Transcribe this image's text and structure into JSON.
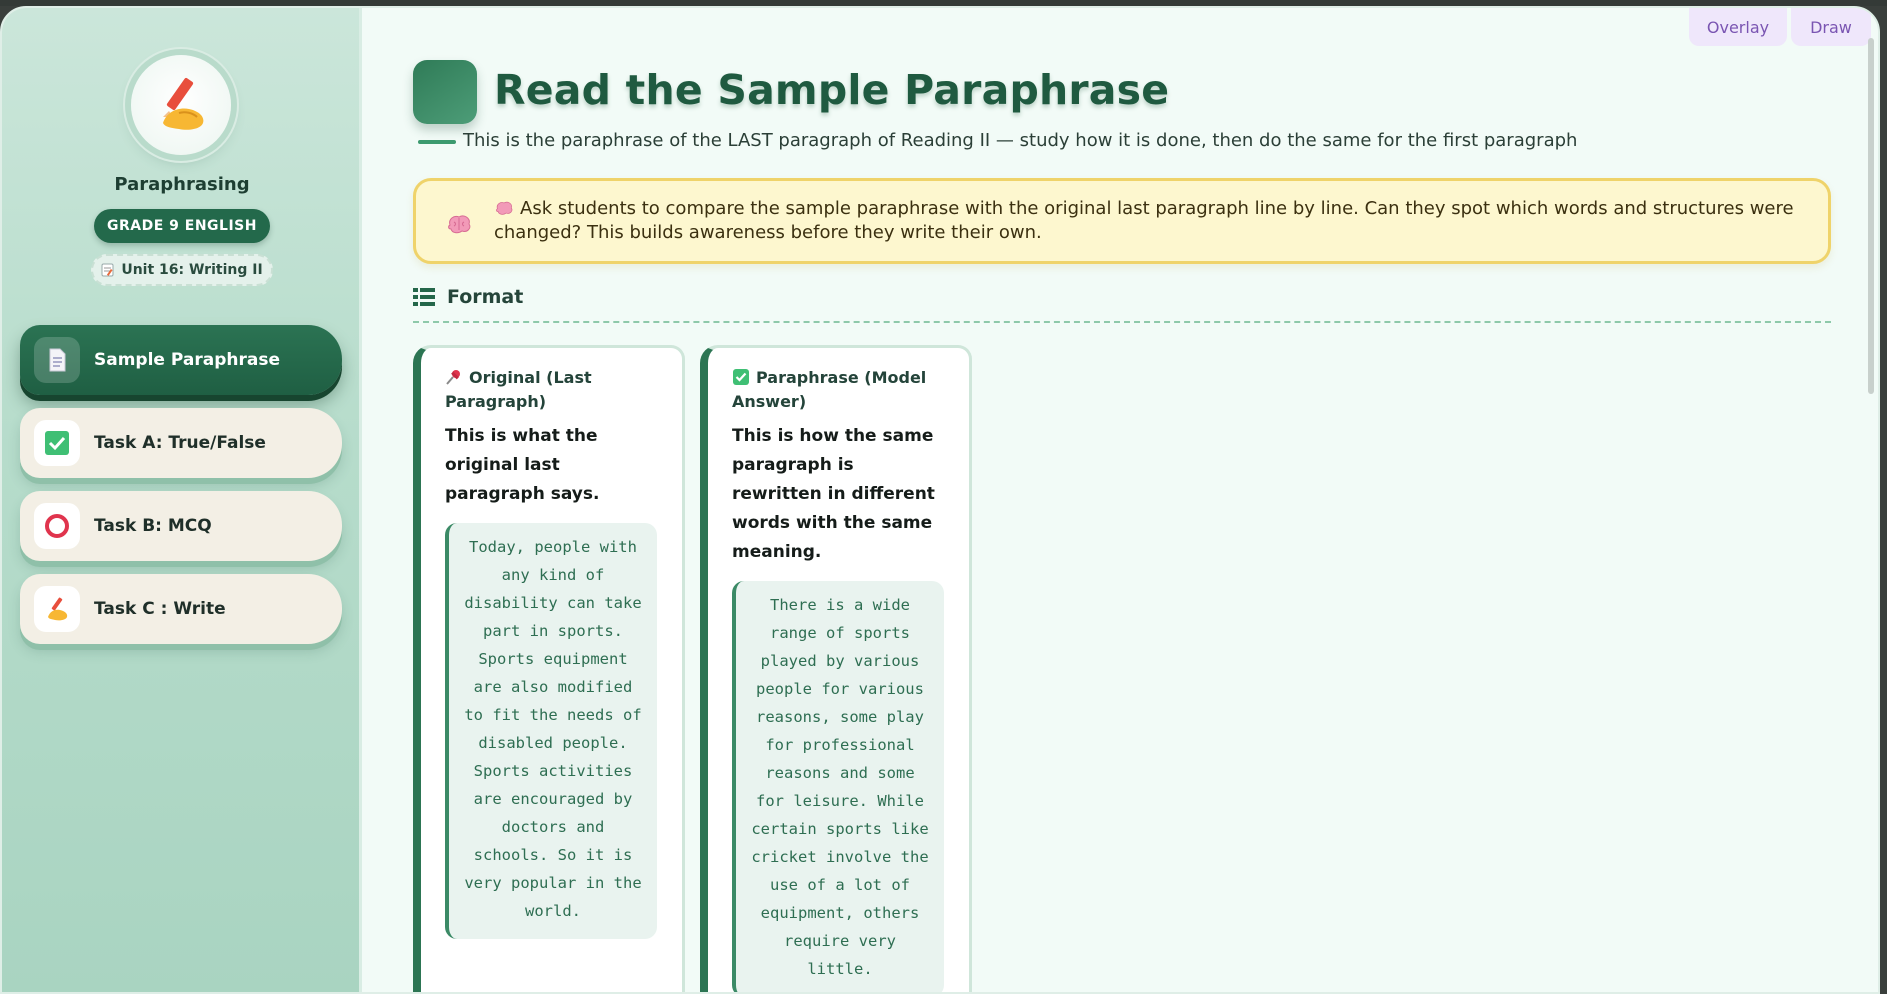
{
  "sidebar": {
    "title": "Paraphrasing",
    "grade_badge": "GRADE 9 ENGLISH",
    "unit": "Unit 16: Writing II",
    "items": [
      {
        "label": "Sample Paraphrase",
        "icon": "document-icon",
        "active": true
      },
      {
        "label": "Task A: True/False",
        "icon": "checkbox-icon",
        "active": false
      },
      {
        "label": "Task B: MCQ",
        "icon": "ring-icon",
        "active": false
      },
      {
        "label": "Task C : Write",
        "icon": "writing-hand-icon",
        "active": false
      }
    ]
  },
  "toolbar": {
    "overlay_label": "Overlay",
    "draw_label": "Draw"
  },
  "main": {
    "title": "Read the Sample Paraphrase",
    "subtitle": "This is the paraphrase of the LAST paragraph of Reading II — study how it is done, then do the same for the first paragraph",
    "tip": "Ask students to compare the sample paraphrase with the original last paragraph line by line. Can they spot which words and structures were changed? This builds awareness before they write their own.",
    "format_heading": "Format",
    "cards": [
      {
        "icon": "pushpin-icon",
        "heading": "Original (Last Paragraph)",
        "description": "This is what the original last paragraph says.",
        "text": "Today, people with any kind of disability can take part in sports. Sports equipment are also modified to fit the needs of disabled people. Sports activities are encouraged by doctors and schools. So it is very popular in the world."
      },
      {
        "icon": "check-mark-icon",
        "heading": "Paraphrase (Model Answer)",
        "description": "This is how the same paragraph is rewritten in different words with the same meaning.",
        "text": "There is a wide range of sports played by various people for various reasons, some play for professional reasons and some for leisure. While certain sports like cricket involve the use of a lot of equipment, others require very little."
      }
    ]
  },
  "colors": {
    "accent": "#23694b",
    "tip_bg": "#fdf7cf",
    "tip_border": "#efd36a",
    "chip": "#efe7fb"
  }
}
